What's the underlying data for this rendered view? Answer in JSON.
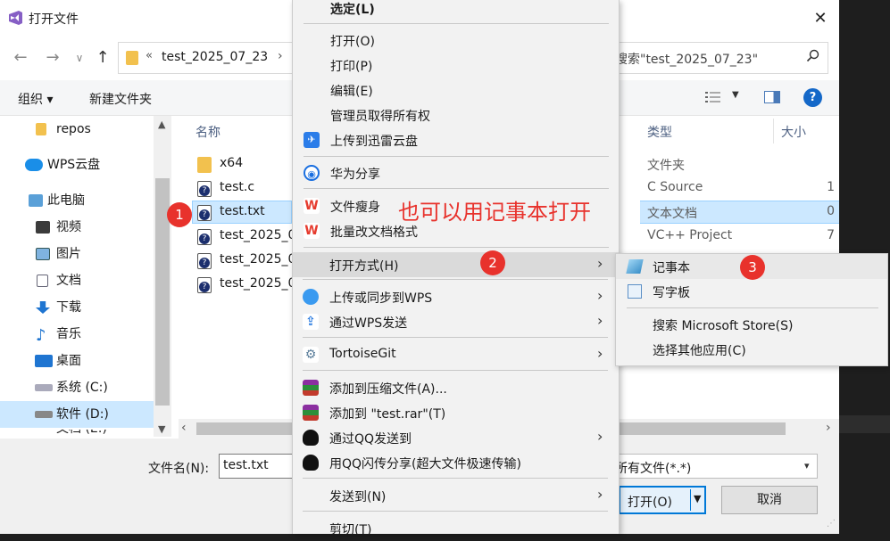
{
  "dialog": {
    "title": "打开文件",
    "close_glyph": "✕",
    "nav": {
      "back": "←",
      "forward": "→",
      "dropdown": "∨",
      "up": "↑"
    },
    "address": {
      "chevron": "«",
      "path": "test_2025_07_23",
      "arrow": "›"
    },
    "search": {
      "placeholder": "搜索\"test_2025_07_23\""
    },
    "toolbar": {
      "organize": "组织 ▾",
      "new_folder": "新建文件夹",
      "help": "?"
    },
    "sidebar": [
      {
        "label": "repos",
        "icon": "folder-icon"
      },
      {
        "label": "WPS云盘",
        "icon": "cloud-icon"
      },
      {
        "label": "此电脑",
        "icon": "computer-icon"
      },
      {
        "label": "视频",
        "icon": "video-icon"
      },
      {
        "label": "图片",
        "icon": "picture-icon"
      },
      {
        "label": "文档",
        "icon": "document-icon"
      },
      {
        "label": "下载",
        "icon": "download-icon"
      },
      {
        "label": "音乐",
        "icon": "music-icon"
      },
      {
        "label": "桌面",
        "icon": "desktop-icon"
      },
      {
        "label": "系统 (C:)",
        "icon": "drive-icon"
      },
      {
        "label": "软件 (D:)",
        "icon": "drive-icon"
      },
      {
        "label": "文档 (E:)",
        "icon": "drive-icon"
      }
    ],
    "columns": {
      "name": "名称",
      "type": "类型",
      "size": "大小"
    },
    "files": [
      {
        "name": "x64",
        "type": "文件夹",
        "size": ""
      },
      {
        "name": "test.c",
        "type": "C Source",
        "size": "1"
      },
      {
        "name": "test.txt",
        "type": "文本文档",
        "size": "0"
      },
      {
        "name": "test_2025_0",
        "type": "VC++ Project",
        "size": "7"
      },
      {
        "name": "test_2025_0",
        "type": "",
        "size": ""
      },
      {
        "name": "test_2025_0",
        "type": "",
        "size": ""
      }
    ],
    "bottom": {
      "filename_label": "文件名(N):",
      "filename_value": "test.txt",
      "filter": "所有文件(*.*)",
      "open": "打开(O)",
      "cancel": "取消"
    }
  },
  "context_menu": {
    "items": [
      {
        "label": "选定(L)",
        "bold": true
      },
      {
        "label": "打开(O)"
      },
      {
        "label": "打印(P)"
      },
      {
        "label": "编辑(E)"
      },
      {
        "label": "管理员取得所有权"
      },
      {
        "label": "上传到迅雷云盘",
        "icon": "xunlei-icon"
      },
      {
        "label": "华为分享",
        "icon": "huawei-share-icon"
      },
      {
        "label": "文件瘦身",
        "icon": "wps-icon"
      },
      {
        "label": "批量改文档格式",
        "icon": "wps-icon"
      },
      {
        "label": "打开方式(H)",
        "submenu": true
      },
      {
        "label": "上传或同步到WPS",
        "icon": "wps-cloud-icon",
        "submenu": true
      },
      {
        "label": "通过WPS发送",
        "icon": "share-icon",
        "submenu": true
      },
      {
        "label": "TortoiseGit",
        "icon": "tortoisegit-icon",
        "submenu": true
      },
      {
        "label": "添加到压缩文件(A)...",
        "icon": "winrar-icon"
      },
      {
        "label": "添加到 \"test.rar\"(T)",
        "icon": "winrar-icon"
      },
      {
        "label": "通过QQ发送到",
        "icon": "qq-icon",
        "submenu": true
      },
      {
        "label": "用QQ闪传分享(超大文件极速传输)",
        "icon": "qq-icon"
      },
      {
        "label": "发送到(N)",
        "submenu": true
      },
      {
        "label": "剪切(T)"
      }
    ]
  },
  "open_with_submenu": {
    "items": [
      {
        "label": "记事本",
        "icon": "notepad-icon"
      },
      {
        "label": "写字板",
        "icon": "wordpad-icon"
      },
      {
        "label": "搜索 Microsoft Store(S)"
      },
      {
        "label": "选择其他应用(C)"
      }
    ]
  },
  "annotations": {
    "badges": [
      "1",
      "2",
      "3"
    ],
    "note": "也可以用记事本打开",
    "color": "#e8322c"
  }
}
